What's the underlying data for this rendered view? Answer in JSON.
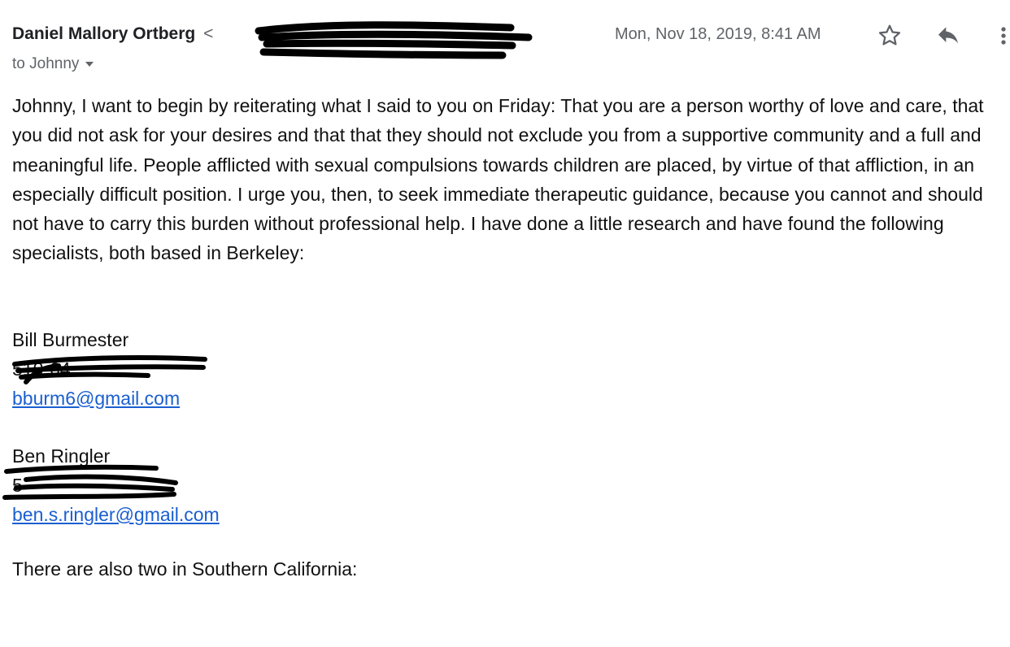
{
  "header": {
    "sender_name": "Daniel Mallory Ortberg",
    "sender_email_prefix": "<",
    "recipient": "to Johnny",
    "timestamp": "Mon, Nov 18, 2019, 8:41 AM",
    "icons": {
      "star": "star-icon",
      "reply": "reply-icon",
      "more": "more-vert-icon"
    }
  },
  "body": {
    "paragraph": "Johnny, I want to begin by reiterating what I said to you on Friday: That you are a person worthy of love and care, that you did not ask for your desires and that that they should not exclude you from a supportive community and a full and meaningful life. People afflicted with sexual compulsions towards children are placed, by virtue of that affliction, in an especially difficult position. I urge you, then, to seek immediate therapeutic guidance, because you cannot and should not have to carry this burden without professional help. I have done a little research and have found the following specialists, both based in Berkeley:",
    "contacts": [
      {
        "name": "Bill Burmester",
        "phone": "510-64",
        "email": "bburm6@gmail.com"
      },
      {
        "name": "Ben Ringler",
        "phone": "5",
        "email": "ben.s.ringler@gmail.com"
      }
    ],
    "closing": "There are also two in Southern California:"
  },
  "colors": {
    "link": "#1a5fd0",
    "meta_text": "#5f6368",
    "redaction": "#000000"
  }
}
